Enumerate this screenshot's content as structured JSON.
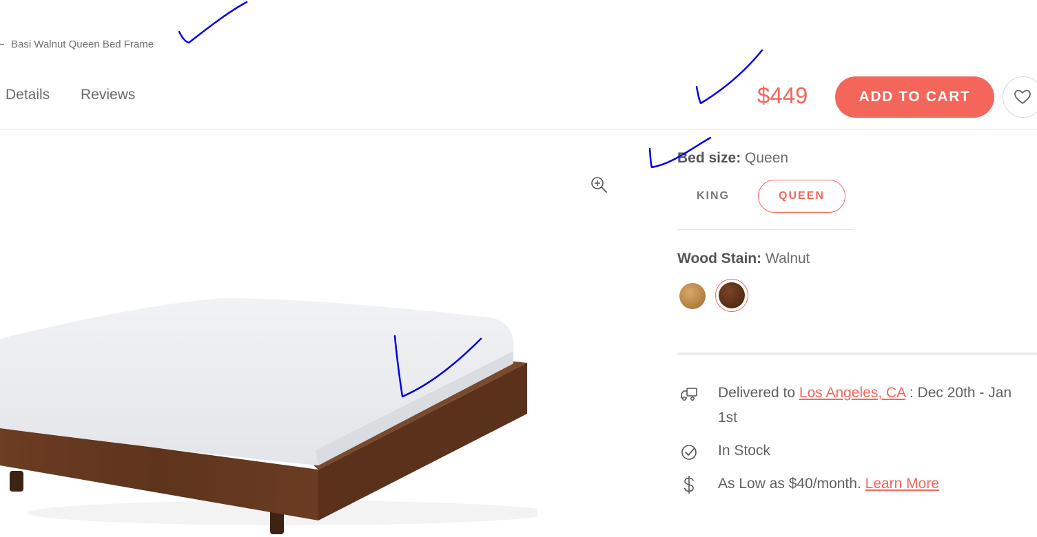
{
  "breadcrumb": {
    "current": "Basi Walnut Queen Bed Frame"
  },
  "subnav": {
    "tabs": [
      {
        "label": "Details"
      },
      {
        "label": "Reviews"
      }
    ],
    "price": "$449",
    "add_to_cart": "ADD TO CART"
  },
  "options": {
    "bed_size": {
      "label": "Bed size:",
      "value": "Queen",
      "choices": [
        {
          "label": "KING",
          "selected": false
        },
        {
          "label": "QUEEN",
          "selected": true
        }
      ]
    },
    "wood_stain": {
      "label": "Wood Stain:",
      "value": "Walnut",
      "swatches": [
        {
          "name": "oak",
          "selected": false,
          "color": "#c08a4a"
        },
        {
          "name": "walnut",
          "selected": true,
          "color": "#5a2f16"
        }
      ]
    }
  },
  "info": {
    "delivery": {
      "prefix": "Delivered to",
      "location": "Los Angeles, CA",
      "suffix": ": Dec 20th - Jan 1st"
    },
    "stock": "In Stock",
    "financing": {
      "text": "As Low as $40/month.",
      "link": "Learn More"
    }
  },
  "icons": [
    "zoom-in-icon",
    "heart-icon",
    "delivery-truck-icon",
    "check-circle-icon",
    "dollar-icon"
  ],
  "colors": {
    "accent": "#f4665a",
    "annotation": "#0000ff"
  }
}
